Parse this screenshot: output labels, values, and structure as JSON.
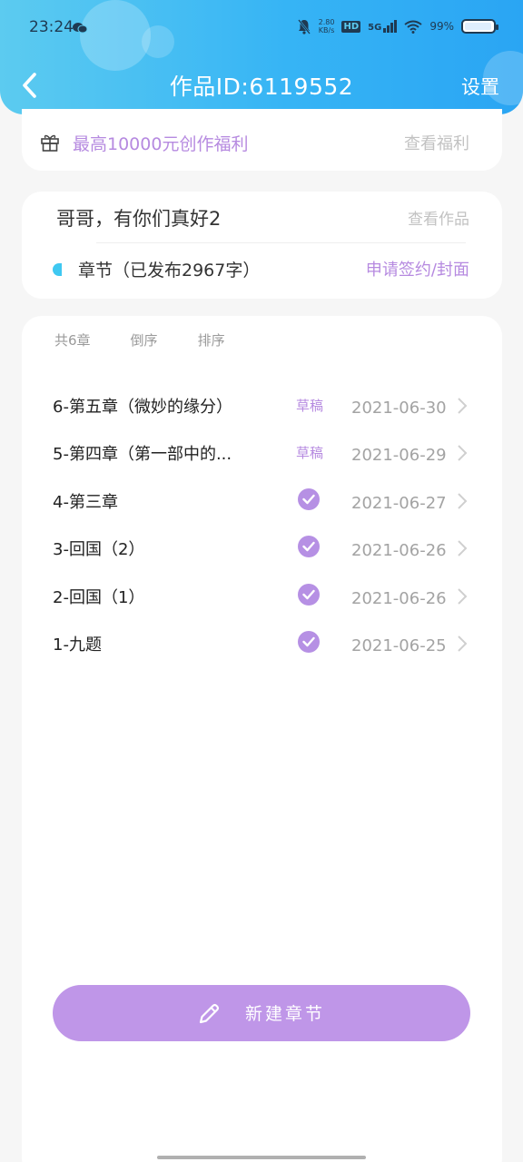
{
  "status_bar": {
    "time": "23:24",
    "net_speed_value": "2.80",
    "net_speed_unit": "KB/s",
    "hd": "HD",
    "signal": "5G",
    "battery": "99%"
  },
  "nav": {
    "title": "作品ID:6119552",
    "settings_label": "设置"
  },
  "gift_banner": {
    "text": "最高10000元创作福利",
    "link": "查看福利"
  },
  "work": {
    "title": "哥哥，有你们真好2",
    "view_link": "查看作品",
    "chapters_label": "章节（已发布2967字）",
    "apply_link": "申请签约/封面"
  },
  "chapter_list": {
    "count_label": "共6章",
    "reverse_label": "倒序",
    "sort_label": "排序",
    "rows": [
      {
        "title": "6-第五章（微妙的缘分）",
        "status": "草稿",
        "date": "2021-06-30"
      },
      {
        "title": "5-第四章（第一部中的...",
        "status": "草稿",
        "date": "2021-06-29"
      },
      {
        "title": "4-第三章",
        "status": "",
        "date": "2021-06-27"
      },
      {
        "title": "3-回国（2）",
        "status": "",
        "date": "2021-06-26"
      },
      {
        "title": "2-回国（1）",
        "status": "",
        "date": "2021-06-26"
      },
      {
        "title": "1-九题",
        "status": "",
        "date": "2021-06-25"
      }
    ]
  },
  "new_chapter_button": "新建章节",
  "colors": {
    "header": "#36b4f5",
    "accent": "#b68ae0",
    "button": "#bf96e8",
    "dot": "#3fc8f1"
  }
}
